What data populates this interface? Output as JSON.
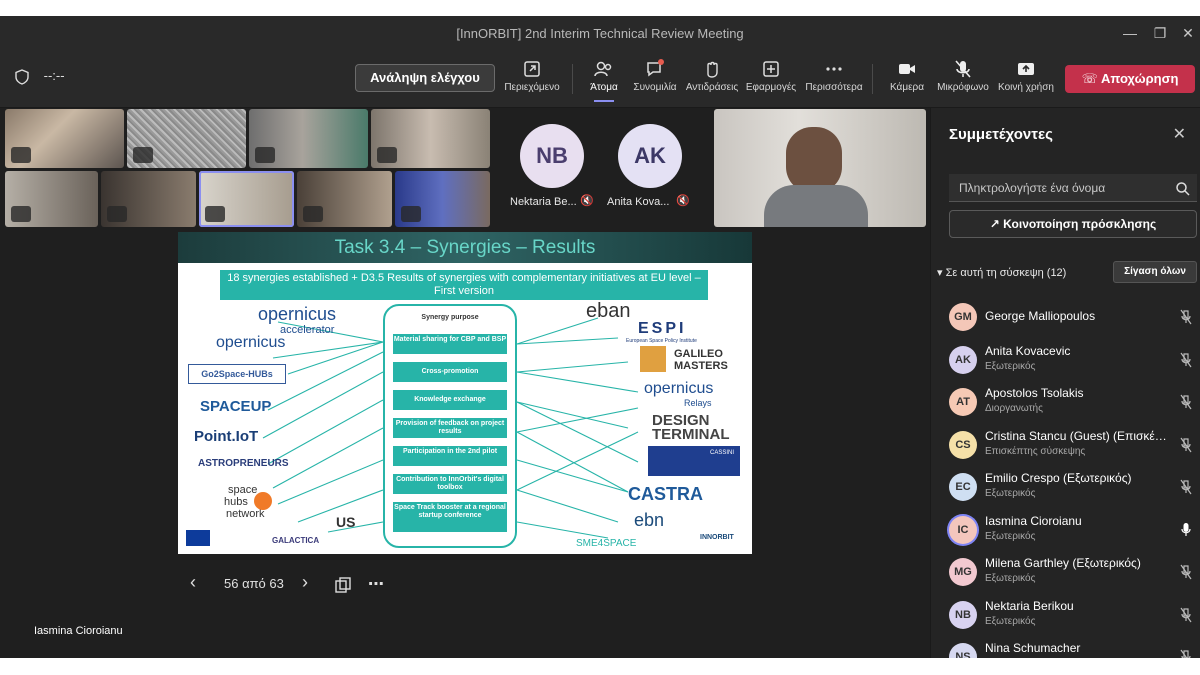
{
  "window": {
    "title": "[InnORBIT] 2nd Interim Technical Review Meeting"
  },
  "toolbar": {
    "timer": "--:--",
    "take_control": "Ανάληψη ελέγχου",
    "items": [
      {
        "label": "Περιεχόμενο",
        "icon": "share-content-icon"
      },
      {
        "label": "Άτομα",
        "icon": "people-icon"
      },
      {
        "label": "Συνομιλία",
        "icon": "chat-icon"
      },
      {
        "label": "Αντιδράσεις",
        "icon": "reactions-icon"
      },
      {
        "label": "Εφαρμογές",
        "icon": "apps-icon"
      },
      {
        "label": "Περισσότερα",
        "icon": "more-icon"
      },
      {
        "label": "Κάμερα",
        "icon": "camera-icon"
      },
      {
        "label": "Μικρόφωνο",
        "icon": "microphone-off-icon"
      },
      {
        "label": "Κοινή χρήση",
        "icon": "share-screen-icon"
      }
    ],
    "leave": "Αποχώρηση"
  },
  "stage": {
    "avatars": [
      {
        "initials": "NB",
        "name": "Nektaria Be..."
      },
      {
        "initials": "AK",
        "name": "Anita Kova..."
      }
    ],
    "self_name": "Iasmina Cioroianu"
  },
  "slide": {
    "title": "Task 3.4 – Synergies – Results",
    "banner": "18 synergies established + D3.5 Results of synergies with complementary initiatives at EU level – First version",
    "purpose_heading": "Synergy purpose",
    "purposes": [
      "Material sharing for CBP and BSP",
      "Cross-promotion",
      "Knowledge exchange",
      "Provision of feedback on project results",
      "Participation in the 2nd pilot",
      "Contribution to InnOrbit's digital toolbox",
      "Space Track booster at a regional startup conference"
    ],
    "left_logos": [
      "opernicus",
      "accelerator",
      "opernicus",
      "Go2Space-HUBs",
      "SPACEUP",
      "Point.IoT",
      "ASTROPRENEURS",
      "space",
      "hubs",
      "network",
      "GALACTICA",
      "US"
    ],
    "right_logos": [
      "eban",
      "ESPI",
      "European Space Policy Institute",
      "GALILEO",
      "MASTERS",
      "opernicus",
      "Relays",
      "DESIGN",
      "TERMINAL",
      "CASSINI",
      "CASTRA",
      "ebn",
      "SME4SPACE",
      "INNORBIT"
    ]
  },
  "slide_controls": {
    "page": "56 από 63"
  },
  "panel": {
    "title": "Συμμετέχοντες",
    "search_placeholder": "Πληκτρολογήστε ένα όνομα",
    "invite": "Κοινοποίηση πρόσκλησης",
    "section": "Σε αυτή τη σύσκεψη (12)",
    "mute_all": "Σίγαση όλων",
    "participants": [
      {
        "initials": "GM",
        "name": "George Malliopoulos",
        "role": "",
        "color": "#f4c7b8"
      },
      {
        "initials": "AK",
        "name": "Anita Kovacevic",
        "role": "Εξωτερικός",
        "color": "#d6d0ee"
      },
      {
        "initials": "AT",
        "name": "Apostolos Tsolakis",
        "role": "Διοργανωτής",
        "color": "#f6c9b4"
      },
      {
        "initials": "CS",
        "name": "Cristina Stancu (Guest) (Επισκέπ...",
        "role": "Επισκέπτης σύσκεψης",
        "color": "#f5e0a8"
      },
      {
        "initials": "EC",
        "name": "Emilio Crespo (Εξωτερικός)",
        "role": "Εξωτερικός",
        "color": "#cfdff2"
      },
      {
        "initials": "IC",
        "name": "Iasmina Cioroianu",
        "role": "Εξωτερικός",
        "color": "#f3c6bd"
      },
      {
        "initials": "MG",
        "name": "Milena Garthley (Εξωτερικός)",
        "role": "Εξωτερικός",
        "color": "#f2c9d0"
      },
      {
        "initials": "NB",
        "name": "Nektaria Berikou",
        "role": "Εξωτερικός",
        "color": "#d8d2f0"
      },
      {
        "initials": "NS",
        "name": "Nina Schumacher",
        "role": "Εξωτερικός",
        "color": "#d6d8f0"
      }
    ]
  }
}
